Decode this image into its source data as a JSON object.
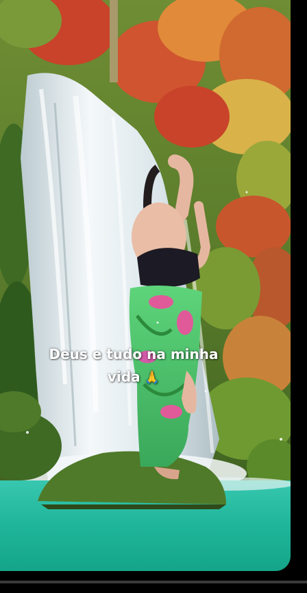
{
  "caption": {
    "line1": "Deus e tudo na minha",
    "line2": "vida",
    "emoji": "🙏"
  },
  "scene": {
    "description_icon": "waterfall-scene",
    "colors": {
      "foliage_red": "#c8432a",
      "foliage_orange": "#e08a3a",
      "foliage_yellow": "#d9b24a",
      "foliage_green": "#5f8a2e",
      "water": "#e6eef2",
      "pool": "#1fb59a",
      "rock_moss": "#4f7a2a",
      "top_garment": "#1c1a24",
      "skirt_green": "#4fc96a",
      "skirt_pink": "#e05a9a"
    }
  }
}
